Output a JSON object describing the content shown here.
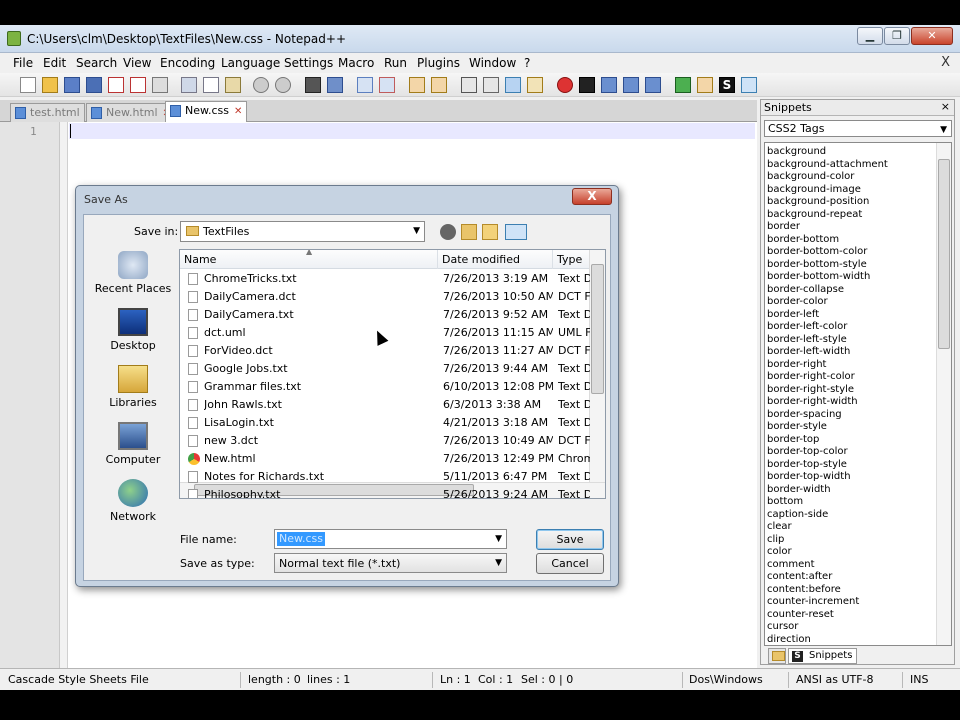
{
  "window": {
    "title": "C:\\Users\\clm\\Desktop\\TextFiles\\New.css - Notepad++"
  },
  "menu": [
    "File",
    "Edit",
    "Search",
    "View",
    "Encoding",
    "Language",
    "Settings",
    "Macro",
    "Run",
    "Plugins",
    "Window",
    "?"
  ],
  "menu_close": "X",
  "tabs": [
    {
      "label": "test.html",
      "active": false
    },
    {
      "label": "New.html",
      "active": false
    },
    {
      "label": "New.css",
      "active": true
    }
  ],
  "editor": {
    "line_number": "1"
  },
  "snippets": {
    "title": "Snippets",
    "close": "×",
    "category": "CSS2 Tags",
    "items": [
      "background",
      "background-attachment",
      "background-color",
      "background-image",
      "background-position",
      "background-repeat",
      "border",
      "border-bottom",
      "border-bottom-color",
      "border-bottom-style",
      "border-bottom-width",
      "border-collapse",
      "border-color",
      "border-left",
      "border-left-color",
      "border-left-style",
      "border-left-width",
      "border-right",
      "border-right-color",
      "border-right-style",
      "border-right-width",
      "border-spacing",
      "border-style",
      "border-top",
      "border-top-color",
      "border-top-style",
      "border-top-width",
      "border-width",
      "bottom",
      "caption-side",
      "clear",
      "clip",
      "color",
      "comment",
      "content:after",
      "content:before",
      "counter-increment",
      "counter-reset",
      "cursor",
      "direction"
    ],
    "tab_label": "Snippets"
  },
  "status": {
    "file_type": "Cascade Style Sheets File",
    "length": "length : 0",
    "lines": "lines : 1",
    "ln": "Ln : 1",
    "col": "Col : 1",
    "sel": "Sel : 0 | 0",
    "eol": "Dos\\Windows",
    "encoding": "ANSI as UTF-8",
    "mode": "INS"
  },
  "dialog": {
    "title": "Save As",
    "close": "X",
    "save_in_label": "Save in:",
    "save_in_value": "TextFiles",
    "places": [
      "Recent Places",
      "Desktop",
      "Libraries",
      "Computer",
      "Network"
    ],
    "columns": [
      "Name",
      "Date modified",
      "Type"
    ],
    "files": [
      {
        "name": "ChromeTricks.txt",
        "date": "7/26/2013 3:19 AM",
        "type": "Text Do",
        "icon": "file"
      },
      {
        "name": "DailyCamera.dct",
        "date": "7/26/2013 10:50 AM",
        "type": "DCT Fi",
        "icon": "file"
      },
      {
        "name": "DailyCamera.txt",
        "date": "7/26/2013 9:52 AM",
        "type": "Text Do",
        "icon": "file"
      },
      {
        "name": "dct.uml",
        "date": "7/26/2013 11:15 AM",
        "type": "UML F",
        "icon": "file"
      },
      {
        "name": "ForVideo.dct",
        "date": "7/26/2013 11:27 AM",
        "type": "DCT Fi",
        "icon": "file"
      },
      {
        "name": "Google Jobs.txt",
        "date": "7/26/2013 9:44 AM",
        "type": "Text Do",
        "icon": "file"
      },
      {
        "name": "Grammar files.txt",
        "date": "6/10/2013 12:08 PM",
        "type": "Text Do",
        "icon": "file"
      },
      {
        "name": "John Rawls.txt",
        "date": "6/3/2013 3:38 AM",
        "type": "Text Do",
        "icon": "file"
      },
      {
        "name": "LisaLogin.txt",
        "date": "4/21/2013 3:18 AM",
        "type": "Text Do",
        "icon": "file"
      },
      {
        "name": "new 3.dct",
        "date": "7/26/2013 10:49 AM",
        "type": "DCT Fi",
        "icon": "file"
      },
      {
        "name": "New.html",
        "date": "7/26/2013 12:49 PM",
        "type": "Chrom",
        "icon": "chrome"
      },
      {
        "name": "Notes for Richards.txt",
        "date": "5/11/2013 6:47 PM",
        "type": "Text Do",
        "icon": "file"
      },
      {
        "name": "Philosophy.txt",
        "date": "5/26/2013 9:24 AM",
        "type": "Text Do",
        "icon": "file"
      }
    ],
    "file_name_label": "File name:",
    "file_name_value": "New.css",
    "save_type_label": "Save as type:",
    "save_type_value": "Normal text file (*.txt)",
    "save_button": "Save",
    "cancel_button": "Cancel"
  }
}
